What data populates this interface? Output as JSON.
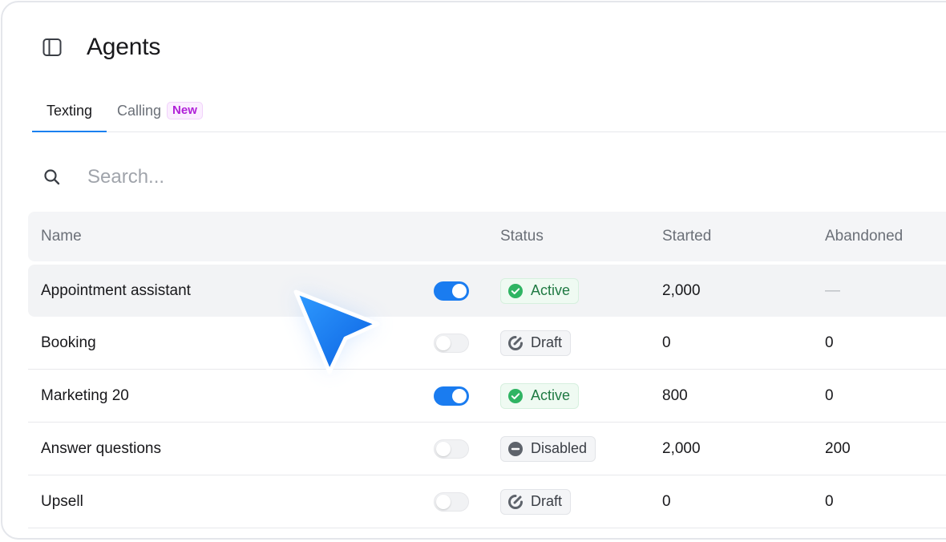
{
  "header": {
    "title": "Agents",
    "toggle_icon": "sidebar-panel-icon"
  },
  "tabs": [
    {
      "label": "Texting",
      "active": true
    },
    {
      "label": "Calling",
      "active": false,
      "badge": "New"
    }
  ],
  "search": {
    "placeholder": "Search...",
    "value": ""
  },
  "table": {
    "columns": [
      "Name",
      "Status",
      "Started",
      "Abandoned"
    ],
    "rows": [
      {
        "name": "Appointment assistant",
        "enabled": true,
        "status": "Active",
        "started": "2,000",
        "abandoned": "—"
      },
      {
        "name": "Booking",
        "enabled": false,
        "status": "Draft",
        "started": "0",
        "abandoned": "0"
      },
      {
        "name": "Marketing 20",
        "enabled": true,
        "status": "Active",
        "started": "800",
        "abandoned": "0"
      },
      {
        "name": "Answer questions",
        "enabled": false,
        "status": "Disabled",
        "started": "2,000",
        "abandoned": "200"
      },
      {
        "name": "Upsell",
        "enabled": false,
        "status": "Draft",
        "started": "0",
        "abandoned": "0"
      }
    ]
  },
  "colors": {
    "accent": "#1a7cf0",
    "active_green": "#1f7a43",
    "badge_purple": "#b020d8"
  }
}
